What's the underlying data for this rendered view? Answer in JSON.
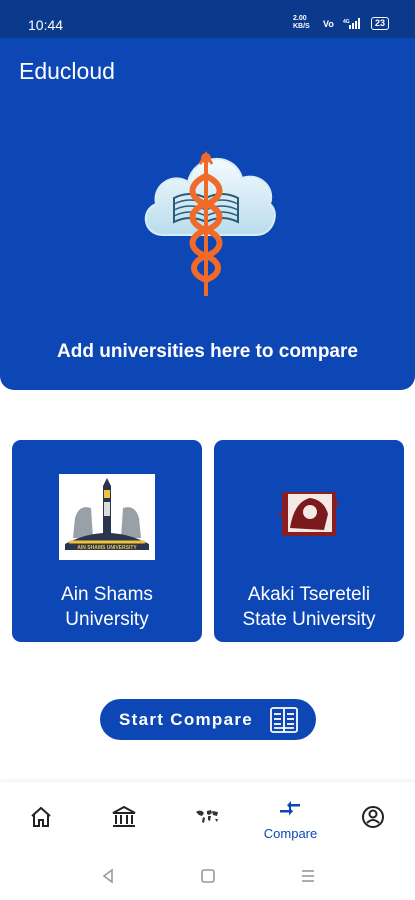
{
  "status_bar": {
    "time": "10:44",
    "battery": "23",
    "net_speed": "2.00 KB/S"
  },
  "app": {
    "title": "Educloud"
  },
  "hero": {
    "caption": "Add universities here to compare"
  },
  "universities": [
    {
      "name": "Ain Shams\nUniversity",
      "logo_caption": "AIN SHAMS UNIVERSITY"
    },
    {
      "name": "Akaki Tsereteli\nState University"
    }
  ],
  "compare_button": {
    "label": "Start Compare"
  },
  "bottom_nav": {
    "items": [
      {
        "icon": "home-icon"
      },
      {
        "icon": "bank-icon"
      },
      {
        "icon": "world-map-icon"
      },
      {
        "icon": "compare-arrows-icon",
        "label": "Compare",
        "active": true
      },
      {
        "icon": "profile-icon"
      }
    ]
  },
  "colors": {
    "primary": "#0d47b5",
    "status_bar": "#0b3a8c",
    "accent": "#f06a2a"
  }
}
